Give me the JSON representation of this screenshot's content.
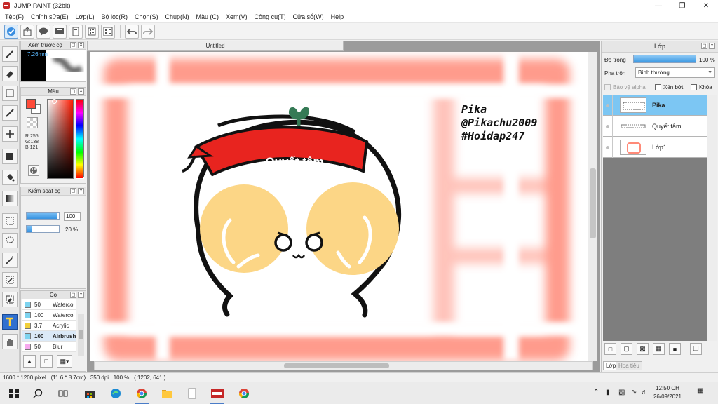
{
  "window": {
    "title": "JUMP PAINT (32bit)"
  },
  "menu": [
    "Tệp(F)",
    "Chỉnh sửa(E)",
    "Lớp(L)",
    "Bộ lọc(R)",
    "Chọn(S)",
    "Chụp(N)",
    "Màu (C)",
    "Xem(V)",
    "Công cụ(T)",
    "Cửa sổ(W)",
    "Help"
  ],
  "panels": {
    "brush_preview": {
      "title": "Xem trước cọ",
      "size": "7.26mm"
    },
    "color": {
      "title": "Màu",
      "r": "R:255",
      "g": "G:138",
      "b": "B:121"
    },
    "control": {
      "title": "Kiểm soát cọ",
      "size_value": "100",
      "density_value": "20 %"
    },
    "brush_list": {
      "title": "Cọ",
      "items": [
        {
          "size": "50",
          "name": "Waterco",
          "color": "#7dd3ef"
        },
        {
          "size": "100",
          "name": "Waterco",
          "color": "#7dd3ef"
        },
        {
          "size": "3.7",
          "name": "Acrylic",
          "color": "#f1d03a"
        },
        {
          "size": "100",
          "name": "Airbrush",
          "color": "#7dd3ef"
        },
        {
          "size": "50",
          "name": "Blur",
          "color": "#f7a9ee"
        }
      ]
    }
  },
  "canvas": {
    "tab_title": "Untitled",
    "watermark": [
      "Pika",
      "@Pikachu2009",
      "#Hoidap247"
    ],
    "banner_text": "Quyết tâm"
  },
  "layers": {
    "title": "Lớp",
    "opacity_label": "Độ trong",
    "opacity_value": "100 %",
    "opacity_level": 1.0,
    "blend_label": "Pha trộn",
    "blend_value": "Bình thường",
    "protect_alpha": "Bảo vệ alpha",
    "clip": "Xén bớt",
    "lock": "Khóa",
    "items": [
      {
        "name": "Pika",
        "selected": true
      },
      {
        "name": "Quyết tâm",
        "selected": false
      },
      {
        "name": "Lớp1",
        "selected": false
      }
    ],
    "tab_layer": "Lớp",
    "tab_texture": "Hoa tiêu"
  },
  "status": {
    "text": "1600 * 1200 pixel   (11.6 * 8.7cm)   350 dpi   100 %   ( 1202, 641 )"
  },
  "taskbar": {
    "time": "12:50 CH",
    "date": "26/09/2021"
  },
  "colors": {
    "accent": "#2f6fd0",
    "banner_red": "#e8241f",
    "cheek": "#fcd686",
    "frame_pink": "#ff8a78",
    "sprout": "#357a55"
  }
}
